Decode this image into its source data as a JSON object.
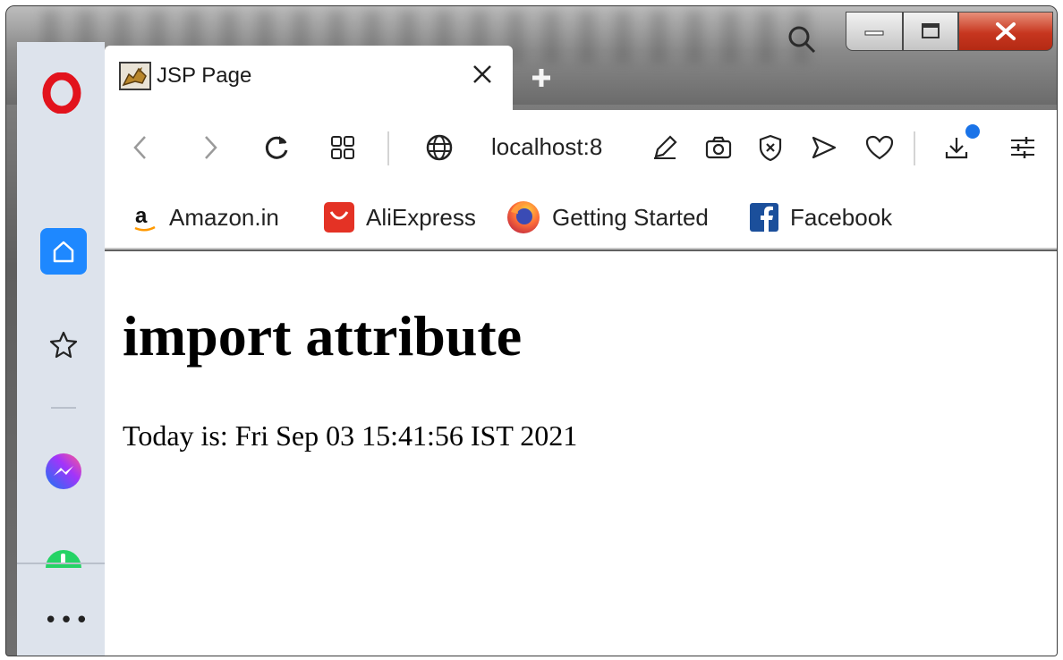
{
  "tab": {
    "title": "JSP Page"
  },
  "address_bar": {
    "url": "localhost:8"
  },
  "bookmarks": [
    {
      "label": "Amazon.in",
      "icon": "amazon-icon"
    },
    {
      "label": "AliExpress",
      "icon": "aliexpress-icon"
    },
    {
      "label": "Getting Started",
      "icon": "firefox-icon"
    },
    {
      "label": "Facebook",
      "icon": "facebook-icon"
    }
  ],
  "page": {
    "heading": "import attribute",
    "text": "Today is: Fri Sep 03 15:41:56 IST 2021"
  },
  "sidebar": {
    "more_label": "•••"
  },
  "colors": {
    "opera_red": "#e2131d",
    "accent_blue": "#1e88ff",
    "download_dot": "#1a73e8",
    "close_button": "#c7361f"
  }
}
